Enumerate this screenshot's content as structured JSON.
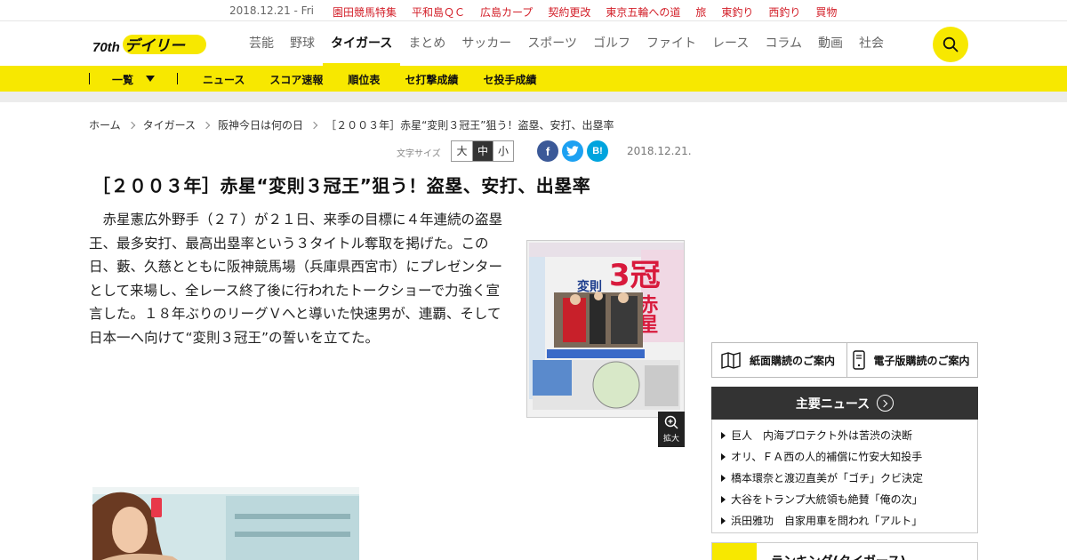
{
  "topbar": {
    "date": "2018.12.21 - Fri",
    "links": [
      "園田競馬特集",
      "平和島ＱＣ",
      "広島カープ",
      "契約更改",
      "東京五輪への道",
      "旅",
      "東釣り",
      "西釣り",
      "買物"
    ]
  },
  "header": {
    "logo_main": "デイリー",
    "logo_badge": "70th",
    "nav": [
      "芸能",
      "野球",
      "タイガース",
      "まとめ",
      "サッカー",
      "スポーツ",
      "ゴルフ",
      "ファイト",
      "レース",
      "コラム",
      "動画",
      "社会"
    ],
    "active_nav": "タイガース"
  },
  "subnav": {
    "list_label": "一覧",
    "links": [
      "ニュース",
      "スコア速報",
      "順位表",
      "セ打撃成績",
      "セ投手成績"
    ]
  },
  "breadcrumb": [
    "ホーム",
    "タイガース",
    "阪神今日は何の日",
    "［２００３年］赤星“変則３冠王”狙う！盗塁、安打、出塁率"
  ],
  "article": {
    "fontsize_label": "文字サイズ",
    "fontsize_options": [
      "大",
      "中",
      "小"
    ],
    "share": [
      "f",
      "t",
      "B!"
    ],
    "date": "2018.12.21.",
    "title": "［２００３年］赤星“変則３冠王”狙う！盗塁、安打、出塁率",
    "body": "赤星憲広外野手（２７）が２１日、来季の目標に４年連続の盗塁王、最多安打、最高出塁率という３タイトル奪取を掲げた。この日、藪、久慈とともに阪神競馬場（兵庫県西宮市）にプレゼンターとして来場し、全レース終了後に行われたトークショーで力強く宣言した。１８年ぶりのリーグＶへと導いた快速男が、連覇、そして日本一へ向けて“変則３冠王”の誓いを立てた。",
    "zoom_label": "拡大",
    "paper_headline_1": "3冠",
    "paper_headline_2": "赤星",
    "paper_headline_3": "変則"
  },
  "sidebar": {
    "subscribe_print": "紙面購読のご案内",
    "subscribe_digital": "電子版購読のご案内",
    "mainnews_title": "主要ニュース",
    "mainnews": [
      "巨人　内海プロテクト外は苦渋の決断",
      "オリ、ＦＡ西の人的補償に竹安大知投手",
      "橋本環奈と渡辺直美が「ゴチ」クビ決定",
      "大谷をトランプ大統領も絶賛「俺の次」",
      "浜田雅功　自家用車を問われ「アルト」"
    ],
    "ranking_title": "ランキング(タイガース)"
  },
  "colors": {
    "brand_yellow": "#f7e800",
    "topbar_link_red": "#d3202a",
    "facebook": "#3b5998",
    "twitter": "#1da1f2",
    "hatena": "#00a4de"
  }
}
